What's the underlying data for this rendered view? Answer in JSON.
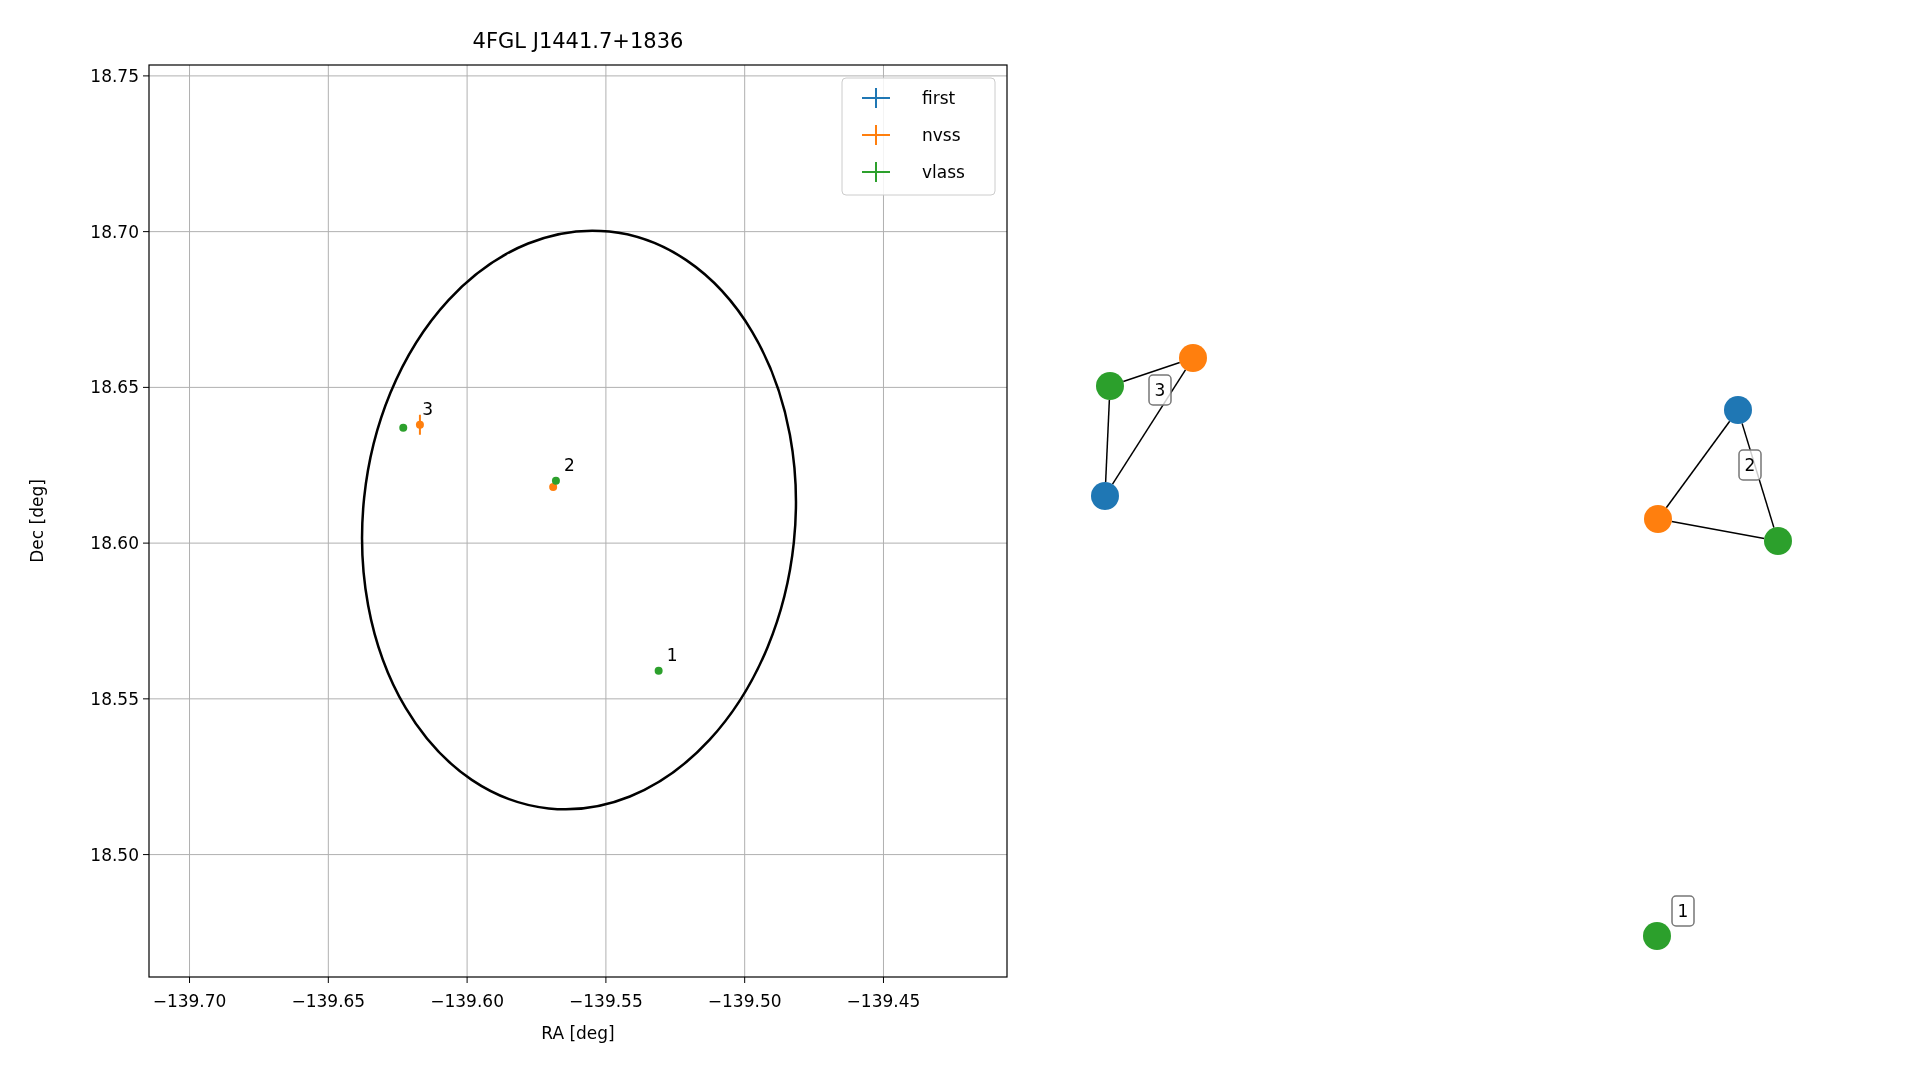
{
  "chart_data": {
    "type": "scatter",
    "title": "4FGL J1441.7+1836",
    "xlabel": "RA [deg]",
    "ylabel": "Dec [deg]",
    "xlim": [
      -139.7146,
      -139.4055
    ],
    "ylim": [
      18.4607,
      18.7535
    ],
    "xticks": [
      {
        "value": -139.7,
        "label": "−139.70"
      },
      {
        "value": -139.65,
        "label": "−139.65"
      },
      {
        "value": -139.6,
        "label": "−139.60"
      },
      {
        "value": -139.55,
        "label": "−139.55"
      },
      {
        "value": -139.5,
        "label": "−139.50"
      },
      {
        "value": -139.45,
        "label": "−139.45"
      }
    ],
    "yticks": [
      {
        "value": 18.5,
        "label": "18.50"
      },
      {
        "value": 18.55,
        "label": "18.55"
      },
      {
        "value": 18.6,
        "label": "18.60"
      },
      {
        "value": 18.65,
        "label": "18.65"
      },
      {
        "value": 18.7,
        "label": "18.70"
      },
      {
        "value": 18.75,
        "label": "18.75"
      }
    ],
    "series": [
      {
        "name": "first",
        "color": "#1f77b4"
      },
      {
        "name": "nvss",
        "color": "#ff7f0e",
        "x": [
          -139.569,
          -139.617
        ],
        "values": [
          18.618,
          18.638
        ]
      },
      {
        "name": "vlass",
        "color": "#2ca02c",
        "x": [
          -139.531,
          -139.568,
          -139.623
        ],
        "values": [
          18.559,
          18.62,
          18.637
        ]
      }
    ],
    "grid": true,
    "legend": true,
    "annotations": [
      {
        "text": "1",
        "x": -139.531,
        "y": 18.559
      },
      {
        "text": "2",
        "x": -139.568,
        "y": 18.62
      },
      {
        "text": "3",
        "x": -139.619,
        "y": 18.638
      }
    ]
  },
  "graph": {
    "groups": [
      {
        "label": "3",
        "nodes": [
          {
            "color": "#2ca02c"
          },
          {
            "color": "#ff7f0e"
          },
          {
            "color": "#1f77b4"
          }
        ]
      },
      {
        "label": "2",
        "nodes": [
          {
            "color": "#1f77b4"
          },
          {
            "color": "#ff7f0e"
          },
          {
            "color": "#2ca02c"
          }
        ]
      },
      {
        "label": "1",
        "nodes": [
          {
            "color": "#2ca02c"
          }
        ]
      }
    ]
  }
}
